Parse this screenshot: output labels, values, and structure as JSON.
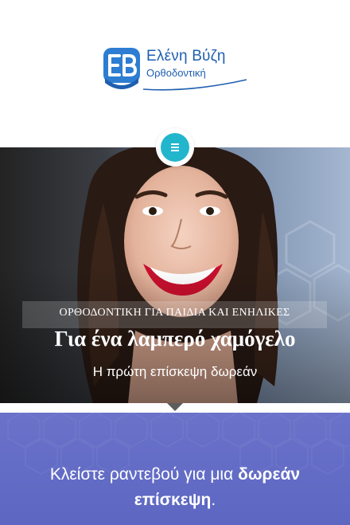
{
  "brand": {
    "name": "Ελένη Βύζη",
    "subtitle": "Ορθοδοντική",
    "color": "#1f5fb0"
  },
  "menu": {
    "icon": "hamburger-icon",
    "color": "#22b6cc"
  },
  "hero": {
    "tagline": "ΟΡΘΟΔΟΝΤΙΚΗ ΓΙΑ ΠΑΙΔΙΑ ΚΑΙ ΕΝΗΛΙΚΕΣ",
    "title": "Για ένα λαμπερό χαμόγελο",
    "subtitle": "Η πρώτη επίσκεψη δωρεάν"
  },
  "booking": {
    "text_normal": "Κλείστε ραντεβού για μια ",
    "text_bold": "δωρεάν επίσκεψη",
    "text_end": ".",
    "background": "#6068c4"
  }
}
